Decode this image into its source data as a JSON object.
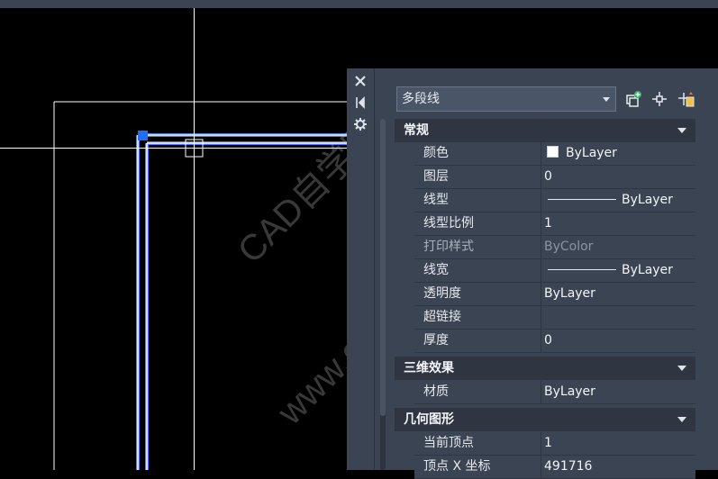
{
  "palette": {
    "object_type": "多段线",
    "strip_icons": [
      "close-icon",
      "autohide-icon",
      "settings-icon"
    ],
    "sections": [
      {
        "title": "常规",
        "rows": [
          {
            "label": "颜色",
            "value": "ByLayer",
            "swatch": "#ffffff"
          },
          {
            "label": "图层",
            "value": "0"
          },
          {
            "label": "线型",
            "value": "ByLayer",
            "line_sample": true
          },
          {
            "label": "线型比例",
            "value": "1"
          },
          {
            "label": "打印样式",
            "value": "ByColor",
            "disabled": true
          },
          {
            "label": "线宽",
            "value": "ByLayer",
            "line_sample": true
          },
          {
            "label": "透明度",
            "value": "ByLayer"
          },
          {
            "label": "超链接",
            "value": ""
          },
          {
            "label": "厚度",
            "value": "0"
          }
        ]
      },
      {
        "title": "三维效果",
        "rows": [
          {
            "label": "材质",
            "value": "ByLayer"
          }
        ]
      },
      {
        "title": "几何图形",
        "rows": [
          {
            "label": "当前顶点",
            "value": "1"
          },
          {
            "label": "顶点 X 坐标",
            "value": "491716"
          }
        ]
      }
    ]
  },
  "watermark": {
    "line1": "CAD自学网",
    "line2": "www.cadzxw.com"
  },
  "colors": {
    "selection_blue": "#4a7bff",
    "grip": "#1e6dff",
    "panel_bg": "#3b4453",
    "header_bg": "#2f3642"
  }
}
